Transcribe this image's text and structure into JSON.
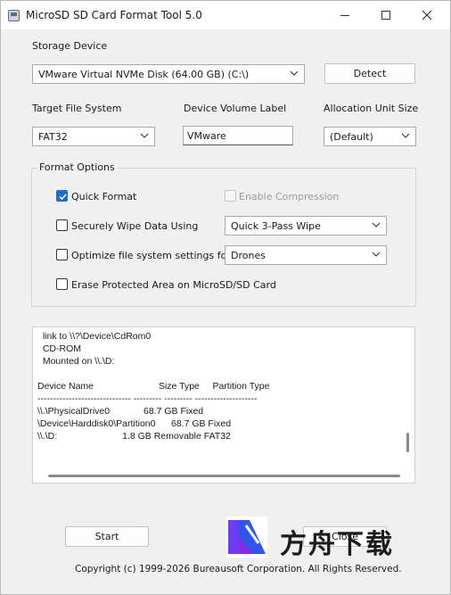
{
  "window": {
    "title": "MicroSD SD Card Format Tool 5.0"
  },
  "storage": {
    "label": "Storage Device",
    "selected": "VMware Virtual NVMe Disk (64.00 GB) (C:\\)",
    "detect_label": "Detect"
  },
  "filesystem": {
    "label": "Target File System",
    "selected": "FAT32"
  },
  "volume": {
    "label": "Device Volume Label",
    "value": "VMware"
  },
  "alloc": {
    "label": "Allocation Unit Size",
    "selected": "(Default)"
  },
  "options": {
    "title": "Format Options",
    "quick_format": {
      "label": "Quick Format",
      "checked": true
    },
    "compression": {
      "label": "Enable Compression",
      "checked": false,
      "disabled": true
    },
    "secure_wipe": {
      "label": "Securely Wipe Data Using",
      "checked": false,
      "method": "Quick 3-Pass Wipe"
    },
    "optimize": {
      "label": "Optimize file system settings for",
      "checked": false,
      "target": "Drones"
    },
    "erase_protected": {
      "label": "Erase Protected Area on MicroSD/SD Card",
      "checked": false
    }
  },
  "log": {
    "lines": [
      "  link to \\\\?\\Device\\CdRom0",
      "  CD-ROM",
      "  Mounted on \\\\.\\D:",
      "",
      "Device Name                         Size Type     Partition Type",
      "------------------------------ --------- --------- --------------------",
      "\\\\.\\PhysicalDrive0             68.7 GB Fixed",
      "\\Device\\Harddisk0\\Partition0      68.7 GB Fixed",
      "\\\\.\\D:                         1.8 GB Removable FAT32"
    ]
  },
  "actions": {
    "start_label": "Start",
    "close_label": "Close"
  },
  "footer": {
    "copyright": "Copyright (c) 1999-2026 Bureausoft Corporation. All Rights Reserved."
  },
  "watermark": {
    "text": "方舟下载",
    "icon": "brand-logo-icon"
  },
  "colors": {
    "accent": "#1a6fd0",
    "window_bg": "#f0f0f0"
  }
}
